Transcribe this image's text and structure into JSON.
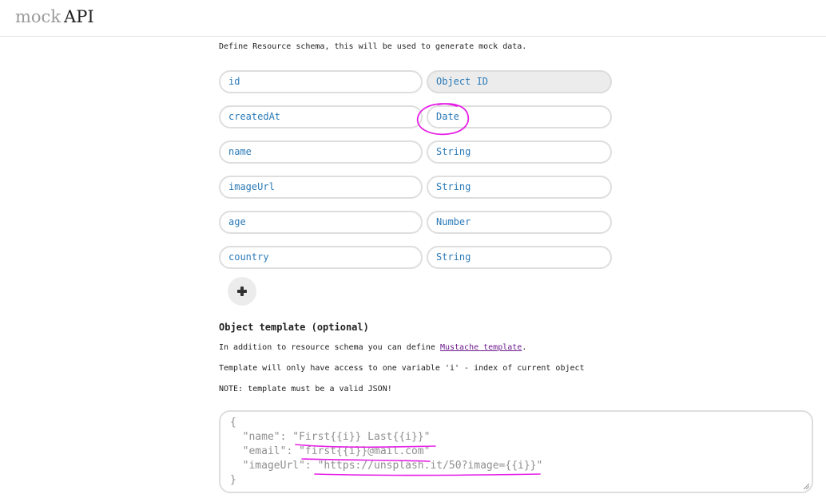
{
  "header": {
    "logo_mock": "mock",
    "logo_api": "API"
  },
  "schema": {
    "intro": "Define Resource schema, this will be used to generate mock data.",
    "fields": [
      {
        "name": "id",
        "type": "Object ID"
      },
      {
        "name": "createdAt",
        "type": "Date"
      },
      {
        "name": "name",
        "type": "String"
      },
      {
        "name": "imageUrl",
        "type": "String"
      },
      {
        "name": "age",
        "type": "Number"
      },
      {
        "name": "country",
        "type": "String"
      }
    ],
    "add_icon": "plus-icon"
  },
  "template": {
    "title": "Object template (optional)",
    "line1_prefix": "In addition to resource schema you can define ",
    "line1_link": "Mustache template",
    "line1_suffix": ".",
    "line2": "Template will only have access to one variable 'i' - index of current object",
    "line3": "NOTE: template must be a valid JSON!",
    "code": [
      "{",
      "  \"name\": \"First{{i}} Last{{i}}\"",
      "  \"email\": \"first{{i}}@mail.com\"",
      "  \"imageUrl\": \"https://unsplash.it/50?image={{i}}\"",
      "}"
    ]
  },
  "colors": {
    "field_text": "#2a7ab8",
    "link": "#6b1a8c",
    "annotation": "#e61ee6"
  }
}
